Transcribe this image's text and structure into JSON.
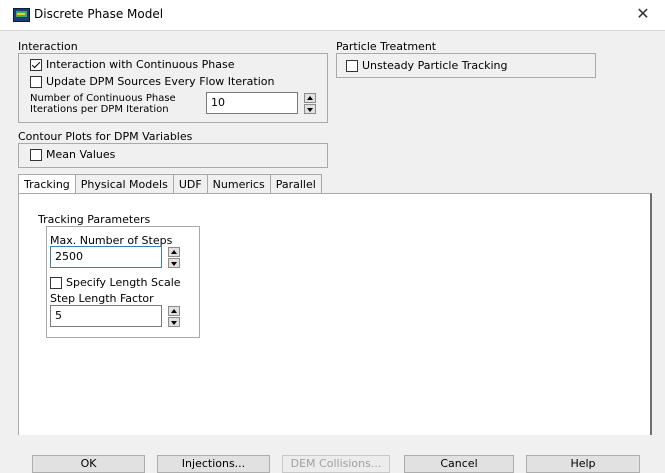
{
  "window": {
    "title": "Discrete Phase Model",
    "close_label": "✕"
  },
  "interaction": {
    "label": "Interaction",
    "interaction_with_continuous": {
      "label": "Interaction with Continuous Phase",
      "checked": true
    },
    "update_dpm_sources": {
      "label": "Update DPM Sources Every Flow Iteration",
      "checked": false
    },
    "num_iterations_label_line1": "Number of Continuous Phase",
    "num_iterations_label_line2": "Iterations per DPM Iteration",
    "num_iterations_value": "10"
  },
  "particle_treatment": {
    "label": "Particle Treatment",
    "unsteady_tracking": {
      "label": "Unsteady Particle Tracking",
      "checked": false
    }
  },
  "contour_plots": {
    "label": "Contour Plots for DPM Variables",
    "mean_values": {
      "label": "Mean Values",
      "checked": false
    }
  },
  "tabs": [
    {
      "label": "Tracking",
      "active": true
    },
    {
      "label": "Physical Models",
      "active": false
    },
    {
      "label": "UDF",
      "active": false
    },
    {
      "label": "Numerics",
      "active": false
    },
    {
      "label": "Parallel",
      "active": false
    }
  ],
  "tracking": {
    "group_label": "Tracking Parameters",
    "max_steps_label": "Max. Number of Steps",
    "max_steps_value": "2500",
    "specify_length_scale": {
      "label": "Specify Length Scale",
      "checked": false
    },
    "step_length_factor_label": "Step Length Factor",
    "step_length_factor_value": "5"
  },
  "buttons": {
    "ok": "OK",
    "injections": "Injections...",
    "dem_collisions": "DEM Collisions...",
    "cancel": "Cancel",
    "help": "Help"
  }
}
